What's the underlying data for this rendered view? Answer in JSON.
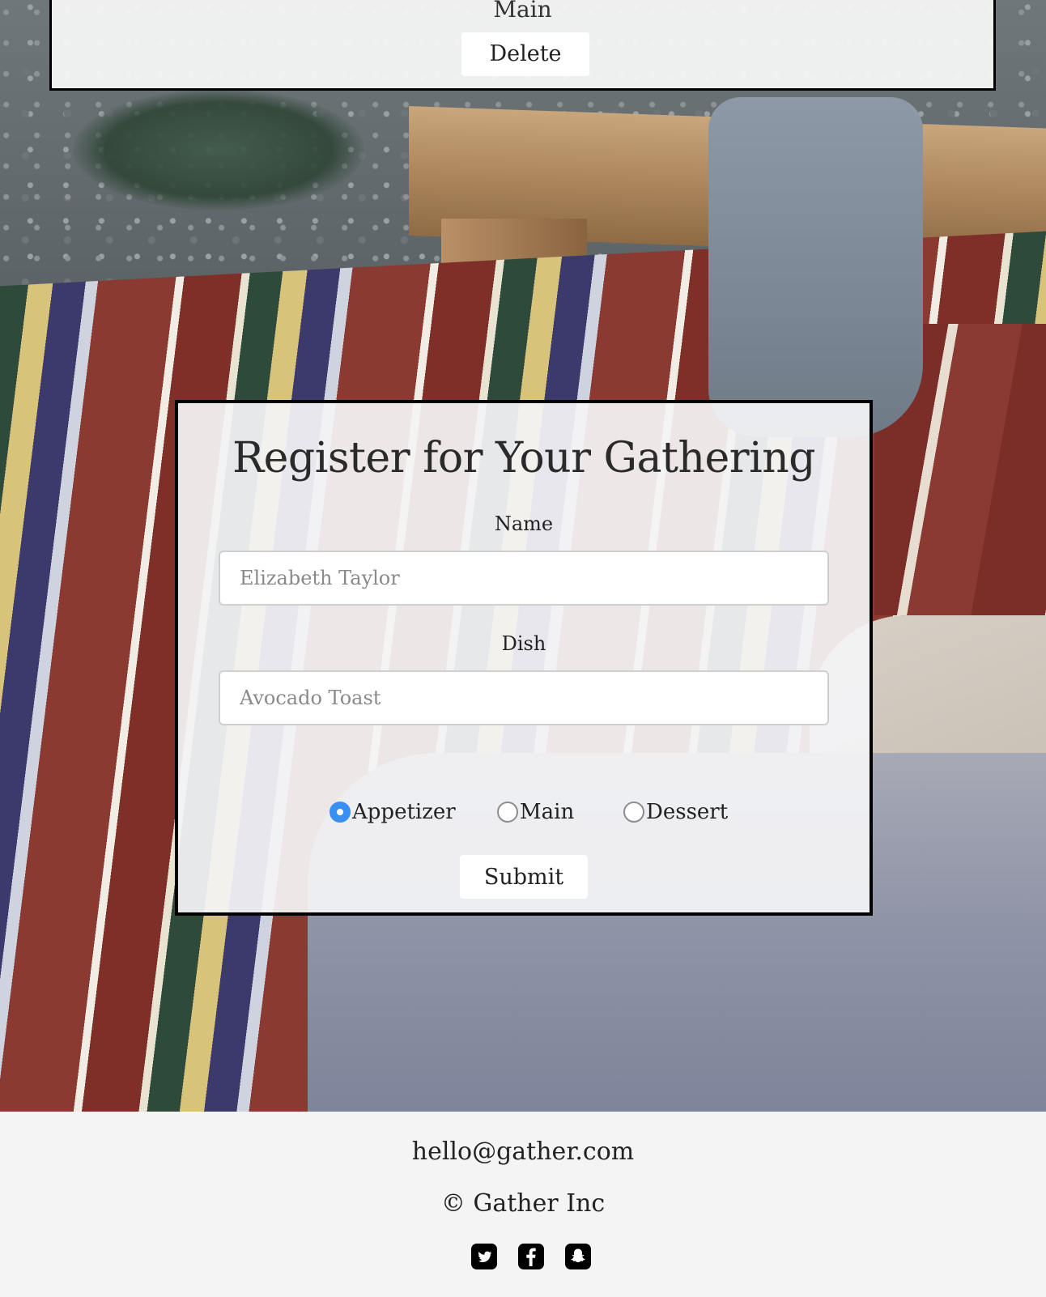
{
  "top_card": {
    "course": "Main",
    "delete_label": "Delete"
  },
  "form": {
    "title": "Register for Your Gathering",
    "name_label": "Name",
    "name_placeholder": "Elizabeth Taylor",
    "dish_label": "Dish",
    "dish_placeholder": "Avocado Toast",
    "course_options": [
      {
        "label": "Appetizer",
        "checked": true
      },
      {
        "label": "Main",
        "checked": false
      },
      {
        "label": "Dessert",
        "checked": false
      }
    ],
    "submit_label": "Submit"
  },
  "footer": {
    "email": "hello@gather.com",
    "copyright": "© Gather Inc",
    "social": [
      "twitter-icon",
      "facebook-icon",
      "snapchat-icon"
    ]
  },
  "colors": {
    "radio_checked": "#3a8ff2",
    "card_border": "#000000",
    "footer_bg": "#f4f4f4"
  }
}
